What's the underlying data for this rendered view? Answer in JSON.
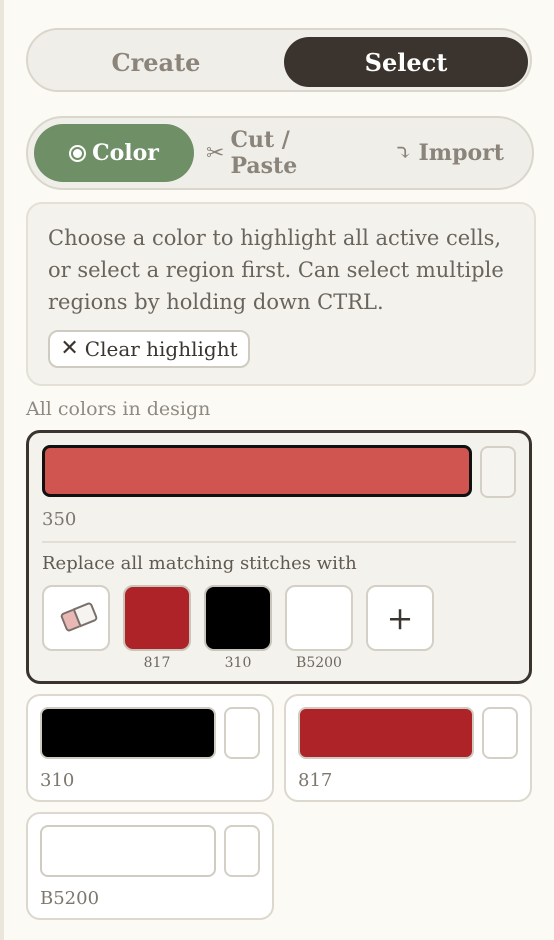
{
  "mode_toggle": {
    "create_label": "Create",
    "select_label": "Select",
    "active": "Select"
  },
  "sub_tabs": {
    "color_label": "Color",
    "cut_paste_label": "Cut / Paste",
    "import_label": "Import",
    "active": "Color"
  },
  "info": {
    "text": "Choose a color to highlight all active cells, or select a region first. Can select multiple regions by holding down CTRL.",
    "clear_label": "Clear highlight"
  },
  "colors_section": {
    "label": "All colors in design",
    "selected": {
      "code": "350",
      "hex": "#d05550",
      "replace_label": "Replace all matching stitches with",
      "options": [
        {
          "code": "817",
          "hex": "#ad2328"
        },
        {
          "code": "310",
          "hex": "#000000"
        },
        {
          "code": "B5200",
          "hex": "#ffffff"
        }
      ],
      "add_symbol": "+"
    },
    "others": [
      {
        "code": "310",
        "hex": "#000000"
      },
      {
        "code": "817",
        "hex": "#ad2328"
      },
      {
        "code": "B5200",
        "hex": "#ffffff"
      }
    ]
  },
  "icons": {
    "color_tab": "radio-icon",
    "cut_tab": "scissors-icon",
    "import_tab": "import-arrow-icon",
    "clear": "x-icon",
    "eraser": "eraser-icon",
    "add": "plus-icon"
  },
  "colors": {
    "active_mode": "#3b342e",
    "active_tab": "#6f8f66",
    "background": "#fbfaf5"
  }
}
